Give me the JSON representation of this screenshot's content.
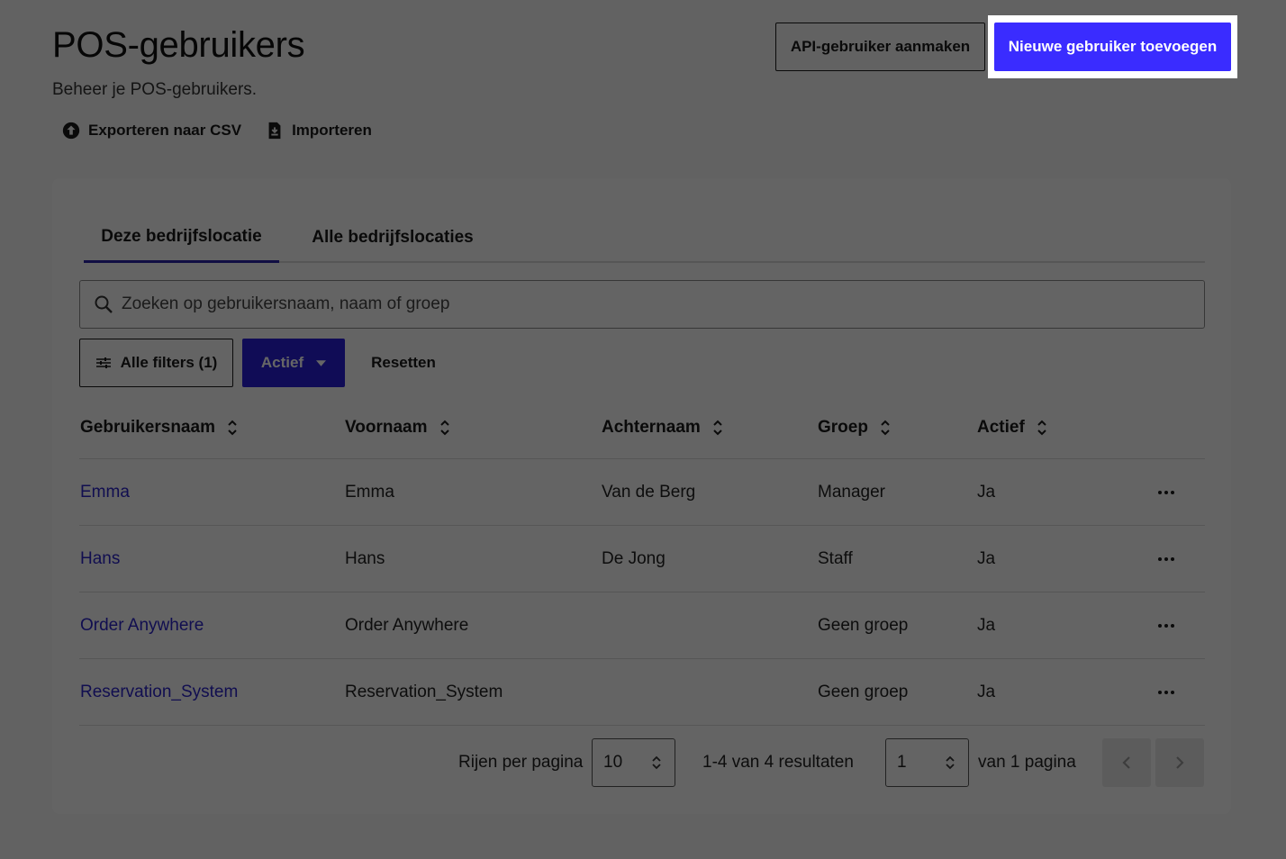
{
  "header": {
    "title": "POS-gebruikers",
    "subtitle": "Beheer je POS-gebruikers.",
    "export_label": "Exporteren naar CSV",
    "import_label": "Importeren",
    "api_button_label": "API-gebruiker aanmaken",
    "new_user_button_label": "Nieuwe gebruiker toevoegen"
  },
  "tabs": [
    {
      "label": "Deze bedrijfslocatie",
      "active": true
    },
    {
      "label": "Alle bedrijfslocaties",
      "active": false
    }
  ],
  "search": {
    "placeholder": "Zoeken op gebruikersnaam, naam of groep",
    "value": ""
  },
  "filters": {
    "all_filters_label": "Alle filters (1)",
    "active_filter_label": "Actief",
    "reset_label": "Resetten"
  },
  "table": {
    "columns": [
      "Gebruikersnaam",
      "Voornaam",
      "Achternaam",
      "Groep",
      "Actief"
    ],
    "rows": [
      {
        "username": "Emma",
        "first_name": "Emma",
        "last_name": "Van de Berg",
        "group": "Manager",
        "active": "Ja"
      },
      {
        "username": "Hans",
        "first_name": "Hans",
        "last_name": "De Jong",
        "group": "Staff",
        "active": "Ja"
      },
      {
        "username": "Order Anywhere",
        "first_name": "Order Anywhere",
        "last_name": "",
        "group": "Geen groep",
        "active": "Ja"
      },
      {
        "username": "Reservation_System",
        "first_name": "Reservation_System",
        "last_name": "",
        "group": "Geen groep",
        "active": "Ja"
      }
    ]
  },
  "pagination": {
    "rows_per_page_label": "Rijen per pagina",
    "rows_per_page_value": "10",
    "results_label": "1-4 van 4 resultaten",
    "page_value": "1",
    "page_total_label": "van 1 pagina"
  },
  "colors": {
    "primary": "#3a2cff",
    "link": "#2b24c8",
    "overlay": "rgba(0,0,0,0.6)"
  }
}
